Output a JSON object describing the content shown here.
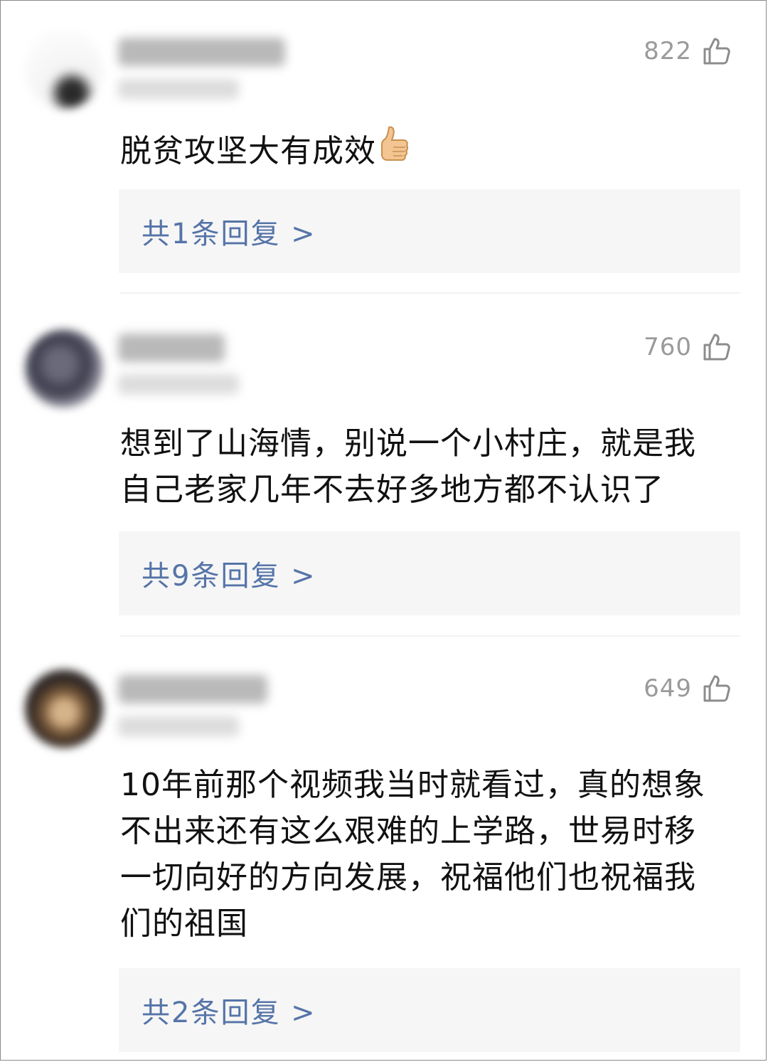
{
  "comments": [
    {
      "likes": "822",
      "text_lines": [
        "脱贫攻坚大有成效"
      ],
      "reply_label": "共1条回复 >"
    },
    {
      "likes": "760",
      "text_lines": [
        "想到了山海情，别说一个小村庄，就是我",
        "自己老家几年不去好多地方都不认识了"
      ],
      "reply_label": "共9条回复 >"
    },
    {
      "likes": "649",
      "text_lines": [
        "10年前那个视频我当时就看过，真的想象",
        "不出来还有这么艰难的上学路，世易时移",
        "一切向好的方向发展，祝福他们也祝福我",
        "们的祖国"
      ],
      "reply_label": "共2条回复 >"
    }
  ],
  "icons": {
    "like": "thumbs-up-outline-icon",
    "emoji": "thumbs-up-emoji-icon"
  },
  "colors": {
    "reply_link": "#5574a8",
    "like_count": "#9a9a9a",
    "reply_background": "#f6f6f6"
  }
}
